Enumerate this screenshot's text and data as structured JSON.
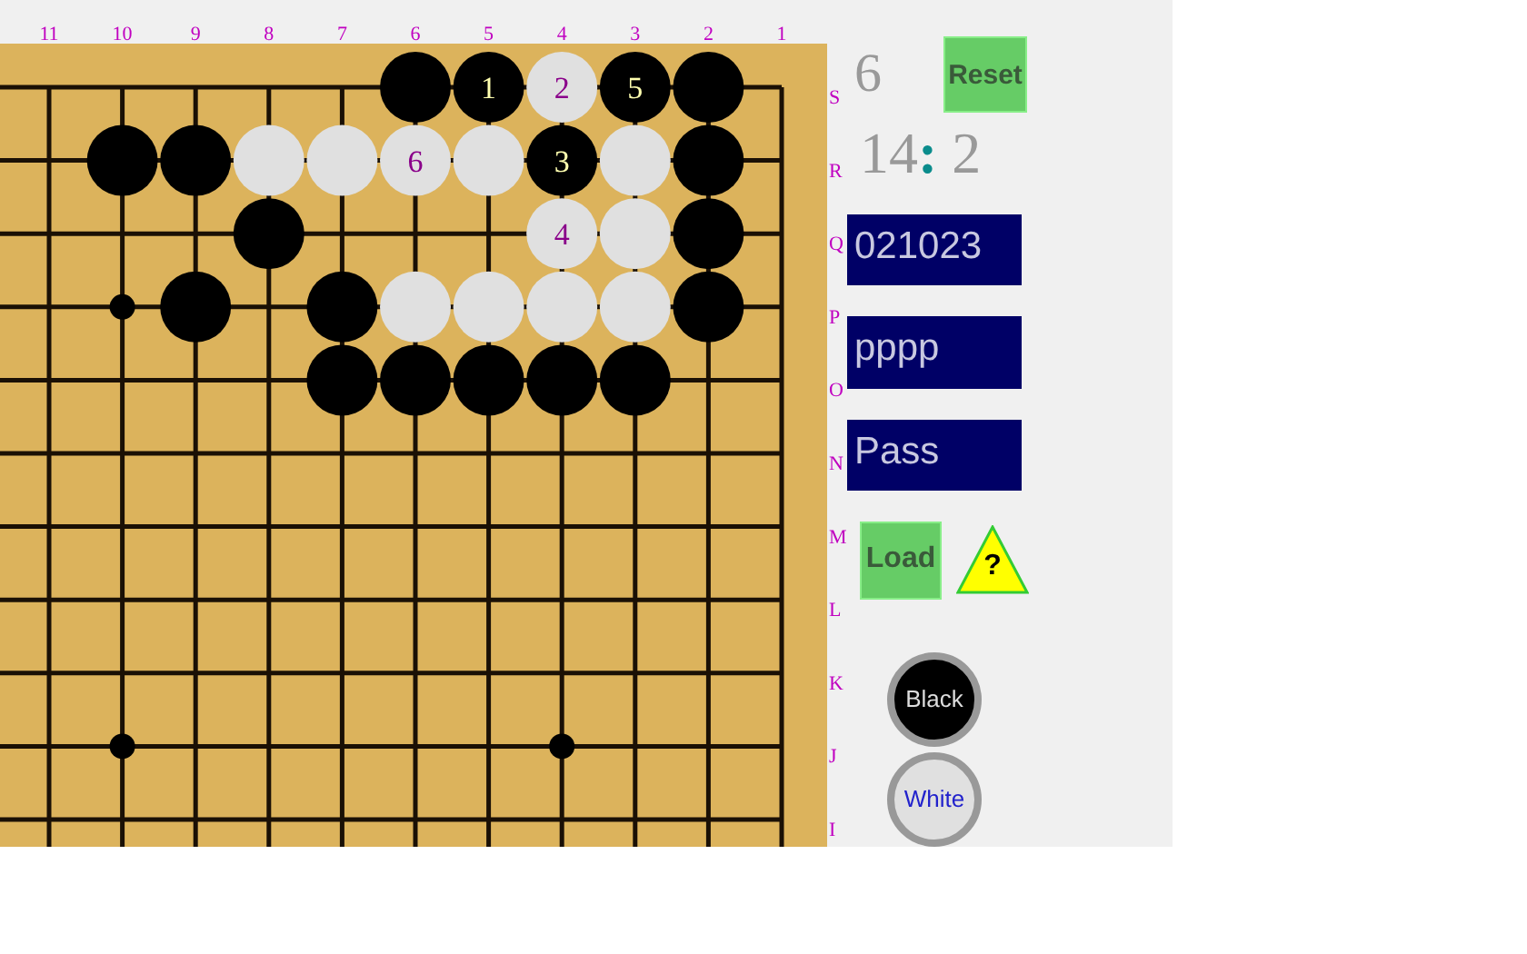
{
  "board": {
    "column_labels": [
      "11",
      "10",
      "9",
      "8",
      "7",
      "6",
      "5",
      "4",
      "3",
      "2",
      "1"
    ],
    "rows": [
      {
        "label": "S",
        "points": [
          {
            "kind": "empty"
          },
          {
            "kind": "empty"
          },
          {
            "kind": "empty"
          },
          {
            "kind": "empty"
          },
          {
            "kind": "empty"
          },
          {
            "kind": "black"
          },
          {
            "kind": "black",
            "number": "1"
          },
          {
            "kind": "white",
            "number": "2"
          },
          {
            "kind": "black",
            "number": "5"
          },
          {
            "kind": "black"
          },
          {
            "kind": "empty"
          }
        ]
      },
      {
        "label": "R",
        "points": [
          {
            "kind": "empty"
          },
          {
            "kind": "black"
          },
          {
            "kind": "black"
          },
          {
            "kind": "white"
          },
          {
            "kind": "white"
          },
          {
            "kind": "white",
            "number": "6"
          },
          {
            "kind": "white"
          },
          {
            "kind": "black",
            "number": "3"
          },
          {
            "kind": "white"
          },
          {
            "kind": "black"
          },
          {
            "kind": "empty"
          }
        ]
      },
      {
        "label": "Q",
        "points": [
          {
            "kind": "empty"
          },
          {
            "kind": "empty"
          },
          {
            "kind": "empty"
          },
          {
            "kind": "black"
          },
          {
            "kind": "empty"
          },
          {
            "kind": "empty"
          },
          {
            "kind": "empty"
          },
          {
            "kind": "white",
            "number": "4"
          },
          {
            "kind": "white"
          },
          {
            "kind": "black"
          },
          {
            "kind": "empty"
          }
        ]
      },
      {
        "label": "P",
        "points": [
          {
            "kind": "empty"
          },
          {
            "kind": "star"
          },
          {
            "kind": "black"
          },
          {
            "kind": "empty"
          },
          {
            "kind": "black"
          },
          {
            "kind": "white"
          },
          {
            "kind": "white"
          },
          {
            "kind": "white"
          },
          {
            "kind": "white"
          },
          {
            "kind": "black"
          },
          {
            "kind": "empty"
          }
        ]
      },
      {
        "label": "O",
        "points": [
          {
            "kind": "empty"
          },
          {
            "kind": "empty"
          },
          {
            "kind": "empty"
          },
          {
            "kind": "empty"
          },
          {
            "kind": "black"
          },
          {
            "kind": "black"
          },
          {
            "kind": "black"
          },
          {
            "kind": "black"
          },
          {
            "kind": "black"
          },
          {
            "kind": "empty"
          },
          {
            "kind": "empty"
          }
        ]
      },
      {
        "label": "N"
      },
      {
        "label": "M"
      },
      {
        "label": "L"
      },
      {
        "label": "K"
      },
      {
        "label": "J",
        "points": [
          {
            "kind": "empty"
          },
          {
            "kind": "star"
          },
          {
            "kind": "empty"
          },
          {
            "kind": "empty"
          },
          {
            "kind": "empty"
          },
          {
            "kind": "empty"
          },
          {
            "kind": "empty"
          },
          {
            "kind": "star"
          },
          {
            "kind": "empty"
          },
          {
            "kind": "empty"
          },
          {
            "kind": "empty"
          }
        ]
      },
      {
        "label": "I"
      }
    ]
  },
  "panel": {
    "move_count": "6",
    "reset_button": "Reset",
    "score": {
      "black": "14",
      "separator": ":",
      "white": "2"
    },
    "fields": [
      {
        "value": "021023"
      },
      {
        "value": "pppp"
      },
      {
        "value": "Pass"
      }
    ],
    "load_button": "Load",
    "help_mark": "?",
    "color_buttons": [
      {
        "kind": "black",
        "label": "Black"
      },
      {
        "kind": "white",
        "label": "White"
      }
    ]
  }
}
